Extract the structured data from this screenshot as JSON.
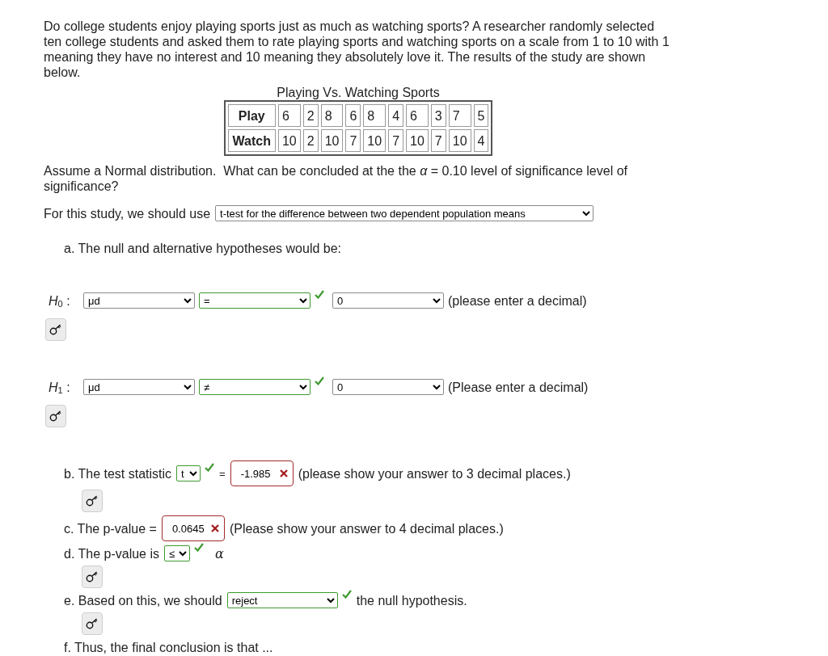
{
  "intro": "Do college students enjoy playing sports just as much as watching sports? A researcher randomly selected ten college students and asked them to rate playing sports and watching sports on a scale from 1 to 10 with 1 meaning they have no interest and 10 meaning they absolutely love it. The results of the study are shown below.",
  "data_table": {
    "title": "Playing Vs. Watching Sports",
    "rows": [
      {
        "header": "Play",
        "cells": [
          "6",
          "2",
          "8",
          "6",
          "8",
          "4",
          "6",
          "3",
          "7",
          "5"
        ]
      },
      {
        "header": "Watch",
        "cells": [
          "10",
          "2",
          "10",
          "7",
          "10",
          "7",
          "10",
          "7",
          "10",
          "4"
        ]
      }
    ]
  },
  "question": "Assume a Normal distribution.  What can be concluded at the the *α* = 0.10 level of significance level of significance?",
  "method": {
    "label": "For this study, we should use",
    "select": {
      "value": "t-test for the difference between two dependent population means"
    }
  },
  "part_a": {
    "label": "a. The null and alternative hypotheses would be:"
  },
  "hypotheses": [
    {
      "label": "*H*$_{0}$ :",
      "parameter": {
        "value": "μd"
      },
      "operator": {
        "value": "=",
        "correct": true
      },
      "null_value": {
        "value": "0"
      },
      "hint": "(please enter a decimal)",
      "key_button": true
    },
    {
      "label": "*H*$_{1}$ :",
      "parameter": {
        "value": "μd"
      },
      "operator": {
        "value": "≠",
        "correct": true
      },
      "null_value": {
        "value": "0"
      },
      "hint": "(Please enter a decimal)",
      "key_button": true
    }
  ],
  "steps": [
    {
      "items": [
        {
          "kind": "text",
          "text": "b. The test statistic"
        },
        {
          "kind": "select",
          "value": "t",
          "correct": true
        },
        {
          "kind": "sign",
          "text": "="
        },
        {
          "kind": "answer",
          "value": "-1.985",
          "correct": false
        },
        {
          "kind": "text",
          "text": "(please show your answer to 3 decimal places.)"
        }
      ],
      "key_button": true
    },
    {
      "items": [
        {
          "kind": "text",
          "text": "c. The p-value ="
        },
        {
          "kind": "answer",
          "value": "0.0645",
          "correct": false
        },
        {
          "kind": "text",
          "text": "(Please show your answer to 4 decimal places.)"
        }
      ],
      "key_button": false
    },
    {
      "items": [
        {
          "kind": "text",
          "text": "d. The p-value is"
        },
        {
          "kind": "select",
          "value": "≤",
          "correct": true
        },
        {
          "kind": "math",
          "text": "α"
        }
      ],
      "key_button": true
    },
    {
      "items": [
        {
          "kind": "text",
          "text": "e. Based on this, we should"
        },
        {
          "kind": "select",
          "value": "reject",
          "correct": true
        },
        {
          "kind": "text",
          "text": "the null hypothesis."
        }
      ],
      "key_button": true
    },
    {
      "items": [
        {
          "kind": "text",
          "text": "f. Thus, the final conclusion is that ..."
        }
      ],
      "key_button": false
    }
  ]
}
